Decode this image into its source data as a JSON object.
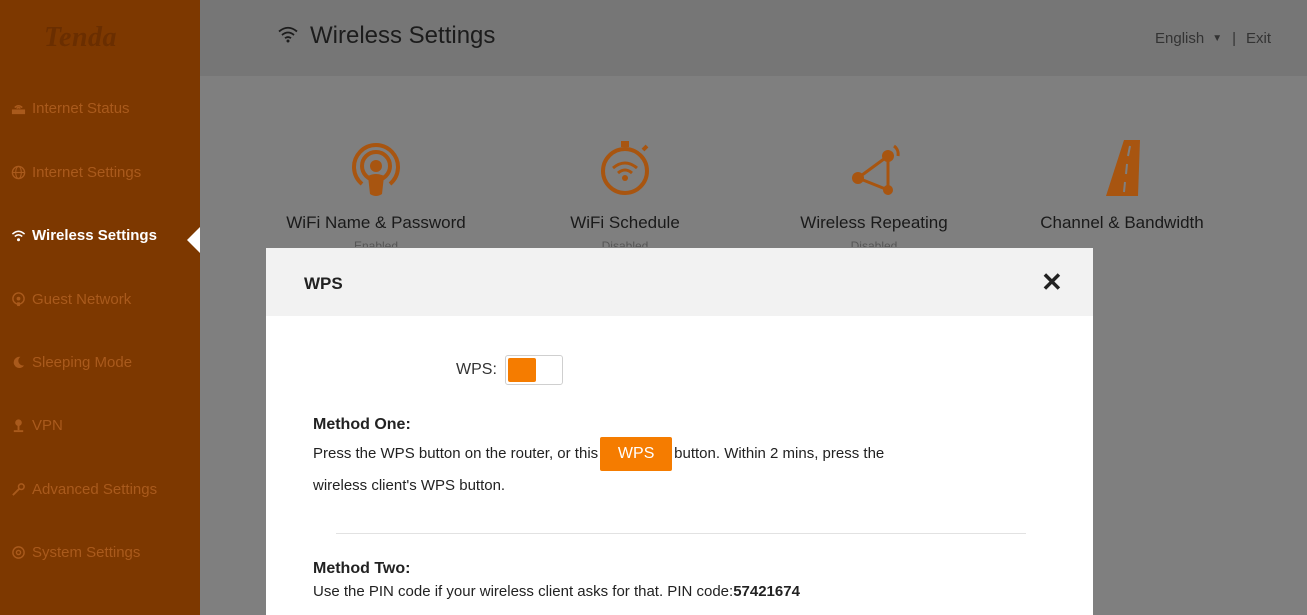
{
  "app": {
    "logo": "Tenda"
  },
  "sidebar": {
    "items": [
      {
        "label": "Internet Status",
        "icon": "router-icon"
      },
      {
        "label": "Internet Settings",
        "icon": "globe-icon"
      },
      {
        "label": "Wireless Settings",
        "icon": "wifi-icon"
      },
      {
        "label": "Guest Network",
        "icon": "guest-icon"
      },
      {
        "label": "Sleeping Mode",
        "icon": "moon-icon"
      },
      {
        "label": "VPN",
        "icon": "vpn-icon"
      },
      {
        "label": "Advanced Settings",
        "icon": "wrench-icon"
      },
      {
        "label": "System Settings",
        "icon": "gear-icon"
      }
    ],
    "active_index": 2
  },
  "header": {
    "title": "Wireless Settings",
    "language": "English",
    "separator": "|",
    "exit": "Exit"
  },
  "cards": [
    {
      "label": "WiFi Name & Password",
      "status": "Enabled",
      "icon": "wifi-name-icon"
    },
    {
      "label": "WiFi Schedule",
      "status": "Disabled",
      "icon": "schedule-icon"
    },
    {
      "label": "Wireless Repeating",
      "status": "Disabled",
      "icon": "repeating-icon"
    },
    {
      "label": "Channel & Bandwidth",
      "status": "",
      "icon": "road-icon"
    }
  ],
  "modal": {
    "title": "WPS",
    "close_glyph": "✕",
    "wps_label": "WPS:",
    "wps_enabled": true,
    "method_one": {
      "title": "Method One:",
      "text_before": "Press the WPS button on the router, or this",
      "button_label": "WPS",
      "text_after": "button. Within 2 mins, press the",
      "text_line2": "wireless client's WPS button."
    },
    "method_two": {
      "title": "Method Two:",
      "text": "Use the PIN code if your wireless client asks for that. PIN code:",
      "pin": "57421674"
    }
  },
  "colors": {
    "sidebar_bg": "#7d3800",
    "accent": "#f57c00",
    "overlay": "#7f7f7f"
  }
}
